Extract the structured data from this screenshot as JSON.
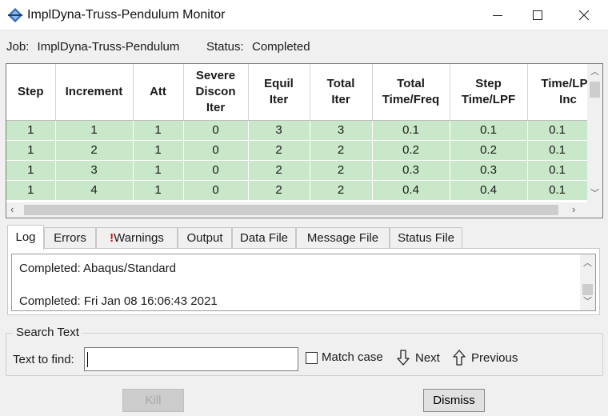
{
  "window": {
    "title": "ImplDyna-Truss-Pendulum Monitor",
    "controls": [
      "minimize-icon",
      "maximize-icon",
      "close-icon"
    ]
  },
  "job": {
    "label": "Job:",
    "name": "ImplDyna-Truss-Pendulum",
    "status_label": "Status:",
    "status_value": "Completed"
  },
  "table": {
    "row_color": "#c9e8c9",
    "headers": [
      "Step",
      "Increment",
      "Att",
      "Severe Discon Iter",
      "Equil Iter",
      "Total Iter",
      "Total Time/Freq",
      "Step Time/LPF",
      "Time/LPF Inc"
    ],
    "rows": [
      [
        "1",
        "1",
        "1",
        "0",
        "3",
        "3",
        "0.1",
        "0.1",
        "0.1"
      ],
      [
        "1",
        "2",
        "1",
        "0",
        "2",
        "2",
        "0.2",
        "0.2",
        "0.1"
      ],
      [
        "1",
        "3",
        "1",
        "0",
        "2",
        "2",
        "0.3",
        "0.3",
        "0.1"
      ],
      [
        "1",
        "4",
        "1",
        "0",
        "2",
        "2",
        "0.4",
        "0.4",
        "0.1"
      ]
    ]
  },
  "tabs": [
    {
      "label": "Log",
      "active": true
    },
    {
      "label": "Errors"
    },
    {
      "label": "Warnings",
      "prefix": "!",
      "prefix_color": "#dd1111"
    },
    {
      "label": "Output"
    },
    {
      "label": "Data File"
    },
    {
      "label": "Message File"
    },
    {
      "label": "Status File"
    }
  ],
  "log": {
    "lines": [
      "Completed: Abaqus/Standard",
      "Completed: Fri Jan 08 16:06:43 2021"
    ]
  },
  "search": {
    "legend": "Search Text",
    "find_label": "Text to find:",
    "find_value": "",
    "match_case_label": "Match case",
    "match_case_checked": false,
    "next_label": "Next",
    "previous_label": "Previous"
  },
  "buttons": {
    "kill_label": "Kill",
    "kill_disabled": true,
    "dismiss_label": "Dismiss"
  }
}
